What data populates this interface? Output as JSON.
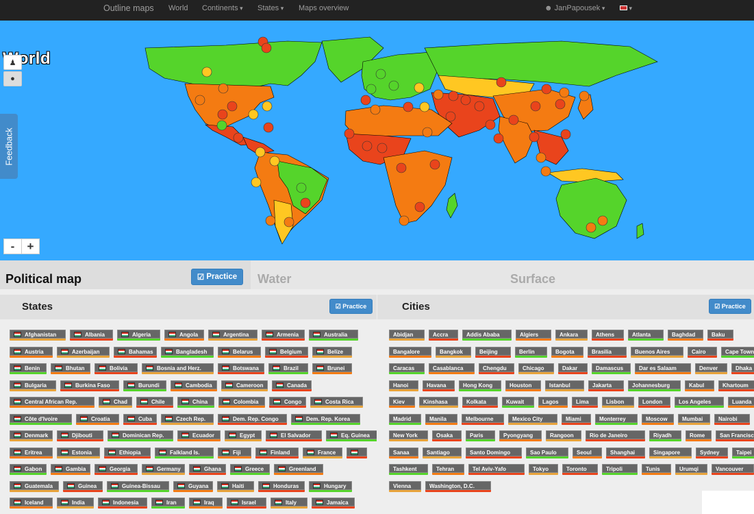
{
  "navbar": {
    "brand": "Outline maps",
    "links": [
      "World",
      "Continents",
      "States",
      "Maps overview"
    ],
    "user": "JanPapousek"
  },
  "map": {
    "title": "World",
    "zoom_out": "-",
    "zoom_in": "+",
    "feedback": "Feedback",
    "colors": {
      "water": "#35a9ff",
      "green": "#55d42b",
      "yellow": "#ffc722",
      "orange": "#f47b12",
      "red": "#e9441c"
    }
  },
  "tabs": {
    "political": "Political map",
    "practice": "Practice",
    "water": "Water",
    "surface": "Surface"
  },
  "states": {
    "title": "States",
    "practice": "Practice",
    "items": [
      [
        "Afghanistan",
        "Albania",
        "Algeria",
        "Angola",
        "Argentina",
        "Armenia",
        "Australia"
      ],
      [
        "Austria",
        "Azerbaijan",
        "Bahamas",
        "Bangladesh",
        "Belarus",
        "Belgium",
        "Belize"
      ],
      [
        "Benin",
        "Bhutan",
        "Bolivia",
        "Bosnia and Herz.",
        "Botswana",
        "Brazil",
        "Brunei"
      ],
      [
        "Bulgaria",
        "Burkina Faso",
        "Burundi",
        "Cambodia",
        "Cameroon",
        "Canada"
      ],
      [
        "Central African Rep.",
        "Chad",
        "Chile",
        "China",
        "Colombia",
        "Congo",
        "Costa Rica"
      ],
      [
        "Côte d'Ivoire",
        "Croatia",
        "Cuba",
        "Czech Rep.",
        "Dem. Rep. Congo",
        "Dem. Rep. Korea"
      ],
      [
        "Denmark",
        "Djibouti",
        "Dominican Rep.",
        "Ecuador",
        "Egypt",
        "El Salvador",
        "Eq. Guinea"
      ],
      [
        "Eritrea",
        "Estonia",
        "Ethiopia",
        "Falkland Is.",
        "Fiji",
        "Finland",
        "France",
        ""
      ],
      [
        "Gabon",
        "Gambia",
        "Georgia",
        "Germany",
        "Ghana",
        "Greece",
        "Greenland"
      ],
      [
        "Guatemala",
        "Guinea",
        "Guinea-Bissau",
        "Guyana",
        "Haiti",
        "Honduras",
        "Hungary"
      ],
      [
        "Iceland",
        "India",
        "Indonesia",
        "Iran",
        "Iraq",
        "Israel",
        "Italy",
        "Jamaica"
      ]
    ]
  },
  "cities": {
    "title": "Cities",
    "practice": "Practice",
    "items": [
      [
        "Abidjan",
        "Accra",
        "Addis Ababa",
        "Algiers",
        "Ankara",
        "Athens",
        "Atlanta",
        "Baghdad",
        "Baku"
      ],
      [
        "Bangalore",
        "Bangkok",
        "Beijing",
        "Berlin",
        "Bogota",
        "Brasilia",
        "Buenos Aires",
        "Cairo",
        "Cape Town"
      ],
      [
        "Caracas",
        "Casablanca",
        "Chengdu",
        "Chicago",
        "Dakar",
        "Damascus",
        "Dar es Salaam",
        "Denver",
        "Dhaka"
      ],
      [
        "Hanoi",
        "Havana",
        "Hong Kong",
        "Houston",
        "Istanbul",
        "Jakarta",
        "Johannesburg",
        "Kabul",
        "Khartoum"
      ],
      [
        "Kiev",
        "Kinshasa",
        "Kolkata",
        "Kuwait",
        "Lagos",
        "Lima",
        "Lisbon",
        "London",
        "Los Angeles",
        "Luanda"
      ],
      [
        "Madrid",
        "Manila",
        "Melbourne",
        "Mexico City",
        "Miami",
        "Monterrey",
        "Moscow",
        "Mumbai",
        "Nairobi"
      ],
      [
        "New York",
        "Osaka",
        "Paris",
        "Pyongyang",
        "Rangoon",
        "Rio de Janeiro",
        "Riyadh",
        "Rome",
        "San Francisco"
      ],
      [
        "Sanaa",
        "Santiago",
        "Santo Domingo",
        "Sao Paulo",
        "Seoul",
        "Shanghai",
        "Singapore",
        "Sydney",
        "Taipei"
      ],
      [
        "Tashkent",
        "Tehran",
        "Tel Aviv-Yafo",
        "Tokyo",
        "Toronto",
        "Tripoli",
        "Tunis",
        "Urumqi",
        "Vancouver"
      ],
      [
        "Vienna",
        "Washington, D.C."
      ]
    ]
  }
}
